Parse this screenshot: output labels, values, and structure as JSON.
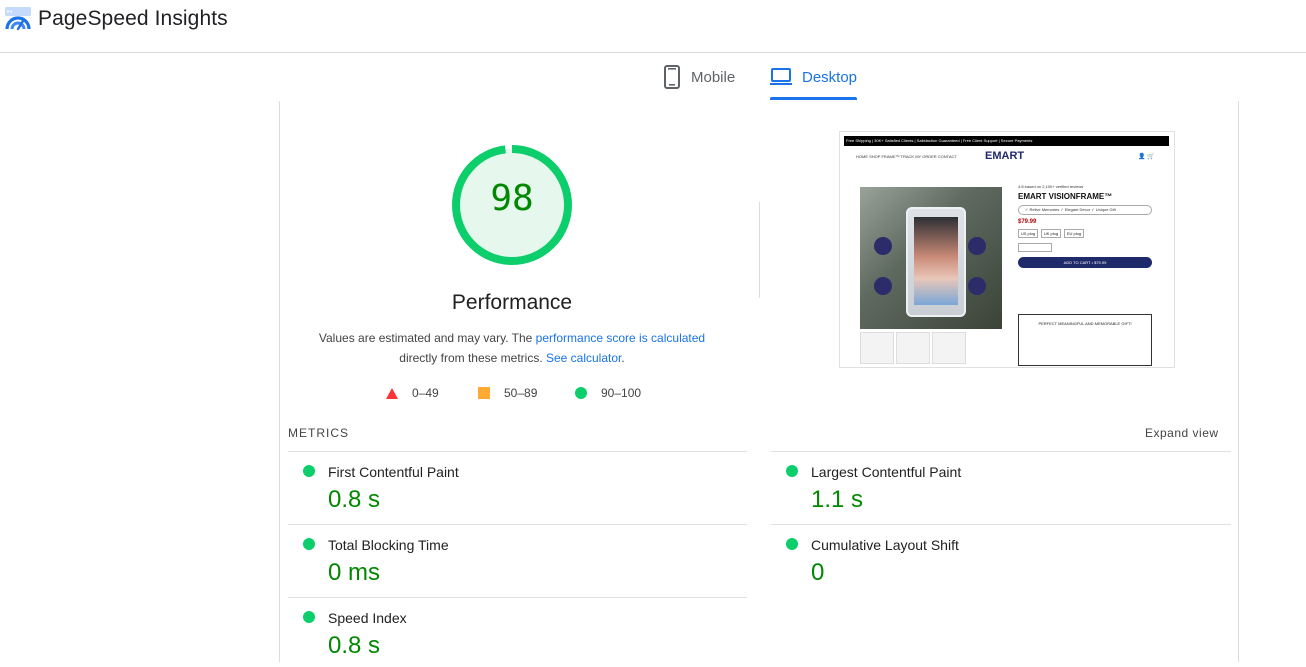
{
  "app": {
    "title": "PageSpeed Insights"
  },
  "tabs": [
    {
      "label": "Mobile",
      "icon": "smartphone-icon",
      "selected": false
    },
    {
      "label": "Desktop",
      "icon": "laptop-icon",
      "selected": true
    }
  ],
  "colors": {
    "accent": "#1a73e8",
    "pass": "#0cce6b",
    "average": "#ffaa33",
    "fail": "#ff3333",
    "pass_text": "#008800"
  },
  "performance": {
    "score": "98",
    "score_fraction": 0.98,
    "title": "Performance",
    "desc_part1": "Values are estimated and may vary. The ",
    "desc_link1": "performance score is calculated",
    "desc_part2": " directly from these metrics. ",
    "desc_link2": "See calculator",
    "desc_part3": "."
  },
  "legend": {
    "fail": "0–49",
    "average": "50–89",
    "pass": "90–100"
  },
  "screenshot": {
    "topbar": "Free Shipping  |  30K+ Satisfied Clients  |  Satisfaction Guaranteed  |  Free Client Support  |  Secure Payments",
    "nav": "HOME    SHOP FRAME™    TRACK MY ORDER    CONTACT",
    "brand": "EMART",
    "rating": "4.8 based on 2,100+ verified reviews",
    "product_title": "EMART VISIONFRAME™",
    "features": "✓ Relive Memories   ✓ Elegant Décor   ✓ Unique Gift",
    "price": "$79.99",
    "sizes": [
      "US plug",
      "UK plug",
      "EU plug"
    ],
    "cart_label": "ADD TO CART  •  $79.99",
    "box_title": "PERFECT MEANINGFUL AND MEMORABLE GIFT!"
  },
  "metrics": {
    "label": "METRICS",
    "expand": "Expand view",
    "items": [
      {
        "name": "First Contentful Paint",
        "value": "0.8 s"
      },
      {
        "name": "Largest Contentful Paint",
        "value": "1.1 s"
      },
      {
        "name": "Total Blocking Time",
        "value": "0 ms"
      },
      {
        "name": "Cumulative Layout Shift",
        "value": "0"
      },
      {
        "name": "Speed Index",
        "value": "0.8 s"
      }
    ]
  }
}
